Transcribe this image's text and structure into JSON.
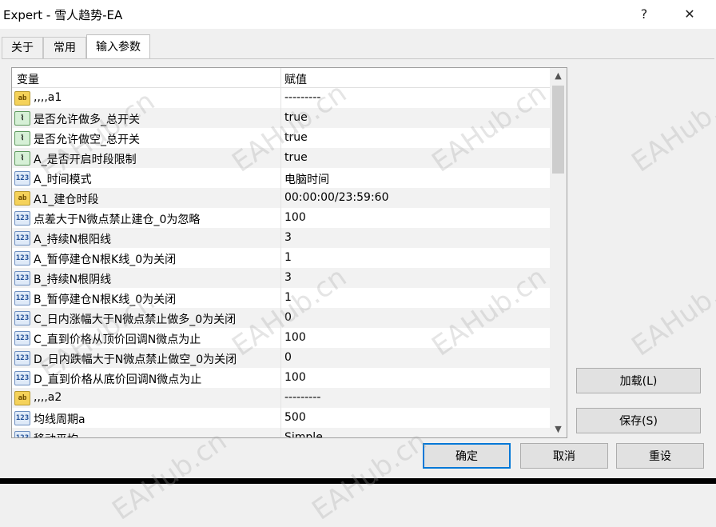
{
  "window": {
    "title": "Expert - 雪人趋势-EA",
    "help_label": "?",
    "close_label": "✕"
  },
  "tabs": [
    {
      "label": "关于"
    },
    {
      "label": "常用"
    },
    {
      "label": "输入参数",
      "active": true
    }
  ],
  "grid": {
    "col_variable": "变量",
    "col_value": "赋值",
    "rows": [
      {
        "icon": "ab",
        "name": ",,,,a1",
        "value": "---------"
      },
      {
        "icon": "bool",
        "name": "是否允许做多_总开关",
        "value": "true"
      },
      {
        "icon": "bool",
        "name": "是否允许做空_总开关",
        "value": "true"
      },
      {
        "icon": "bool",
        "name": "A_是否开启时段限制",
        "value": "true"
      },
      {
        "icon": "num",
        "name": "A_时间模式",
        "value": "电脑时间"
      },
      {
        "icon": "ab",
        "name": "A1_建仓时段",
        "value": "00:00:00/23:59:60"
      },
      {
        "icon": "num",
        "name": "点差大于N微点禁止建仓_0为忽略",
        "value": "100"
      },
      {
        "icon": "num",
        "name": "A_持续N根阳线",
        "value": "3"
      },
      {
        "icon": "num",
        "name": "A_暂停建仓N根K线_0为关闭",
        "value": "1"
      },
      {
        "icon": "num",
        "name": "B_持续N根阴线",
        "value": "3"
      },
      {
        "icon": "num",
        "name": "B_暂停建仓N根K线_0为关闭",
        "value": "1"
      },
      {
        "icon": "num",
        "name": "C_日内涨幅大于N微点禁止做多_0为关闭",
        "value": "0"
      },
      {
        "icon": "num",
        "name": "C_直到价格从顶价回调N微点为止",
        "value": "100"
      },
      {
        "icon": "num",
        "name": "D_日内跌幅大于N微点禁止做空_0为关闭",
        "value": "0"
      },
      {
        "icon": "num",
        "name": "D_直到价格从底价回调N微点为止",
        "value": "100"
      },
      {
        "icon": "ab",
        "name": ",,,,a2",
        "value": "---------"
      },
      {
        "icon": "num",
        "name": "均线周期a",
        "value": "500"
      },
      {
        "icon": "num",
        "name": "移动平均",
        "value": "Simple"
      }
    ]
  },
  "side_buttons": {
    "load": "加载(L)",
    "save": "保存(S)"
  },
  "footer_buttons": {
    "ok": "确定",
    "cancel": "取消",
    "reset": "重设"
  },
  "icon_text": {
    "ab": "ab",
    "num": "123",
    "bool": "⌇"
  },
  "watermark": "EAHub.cn"
}
